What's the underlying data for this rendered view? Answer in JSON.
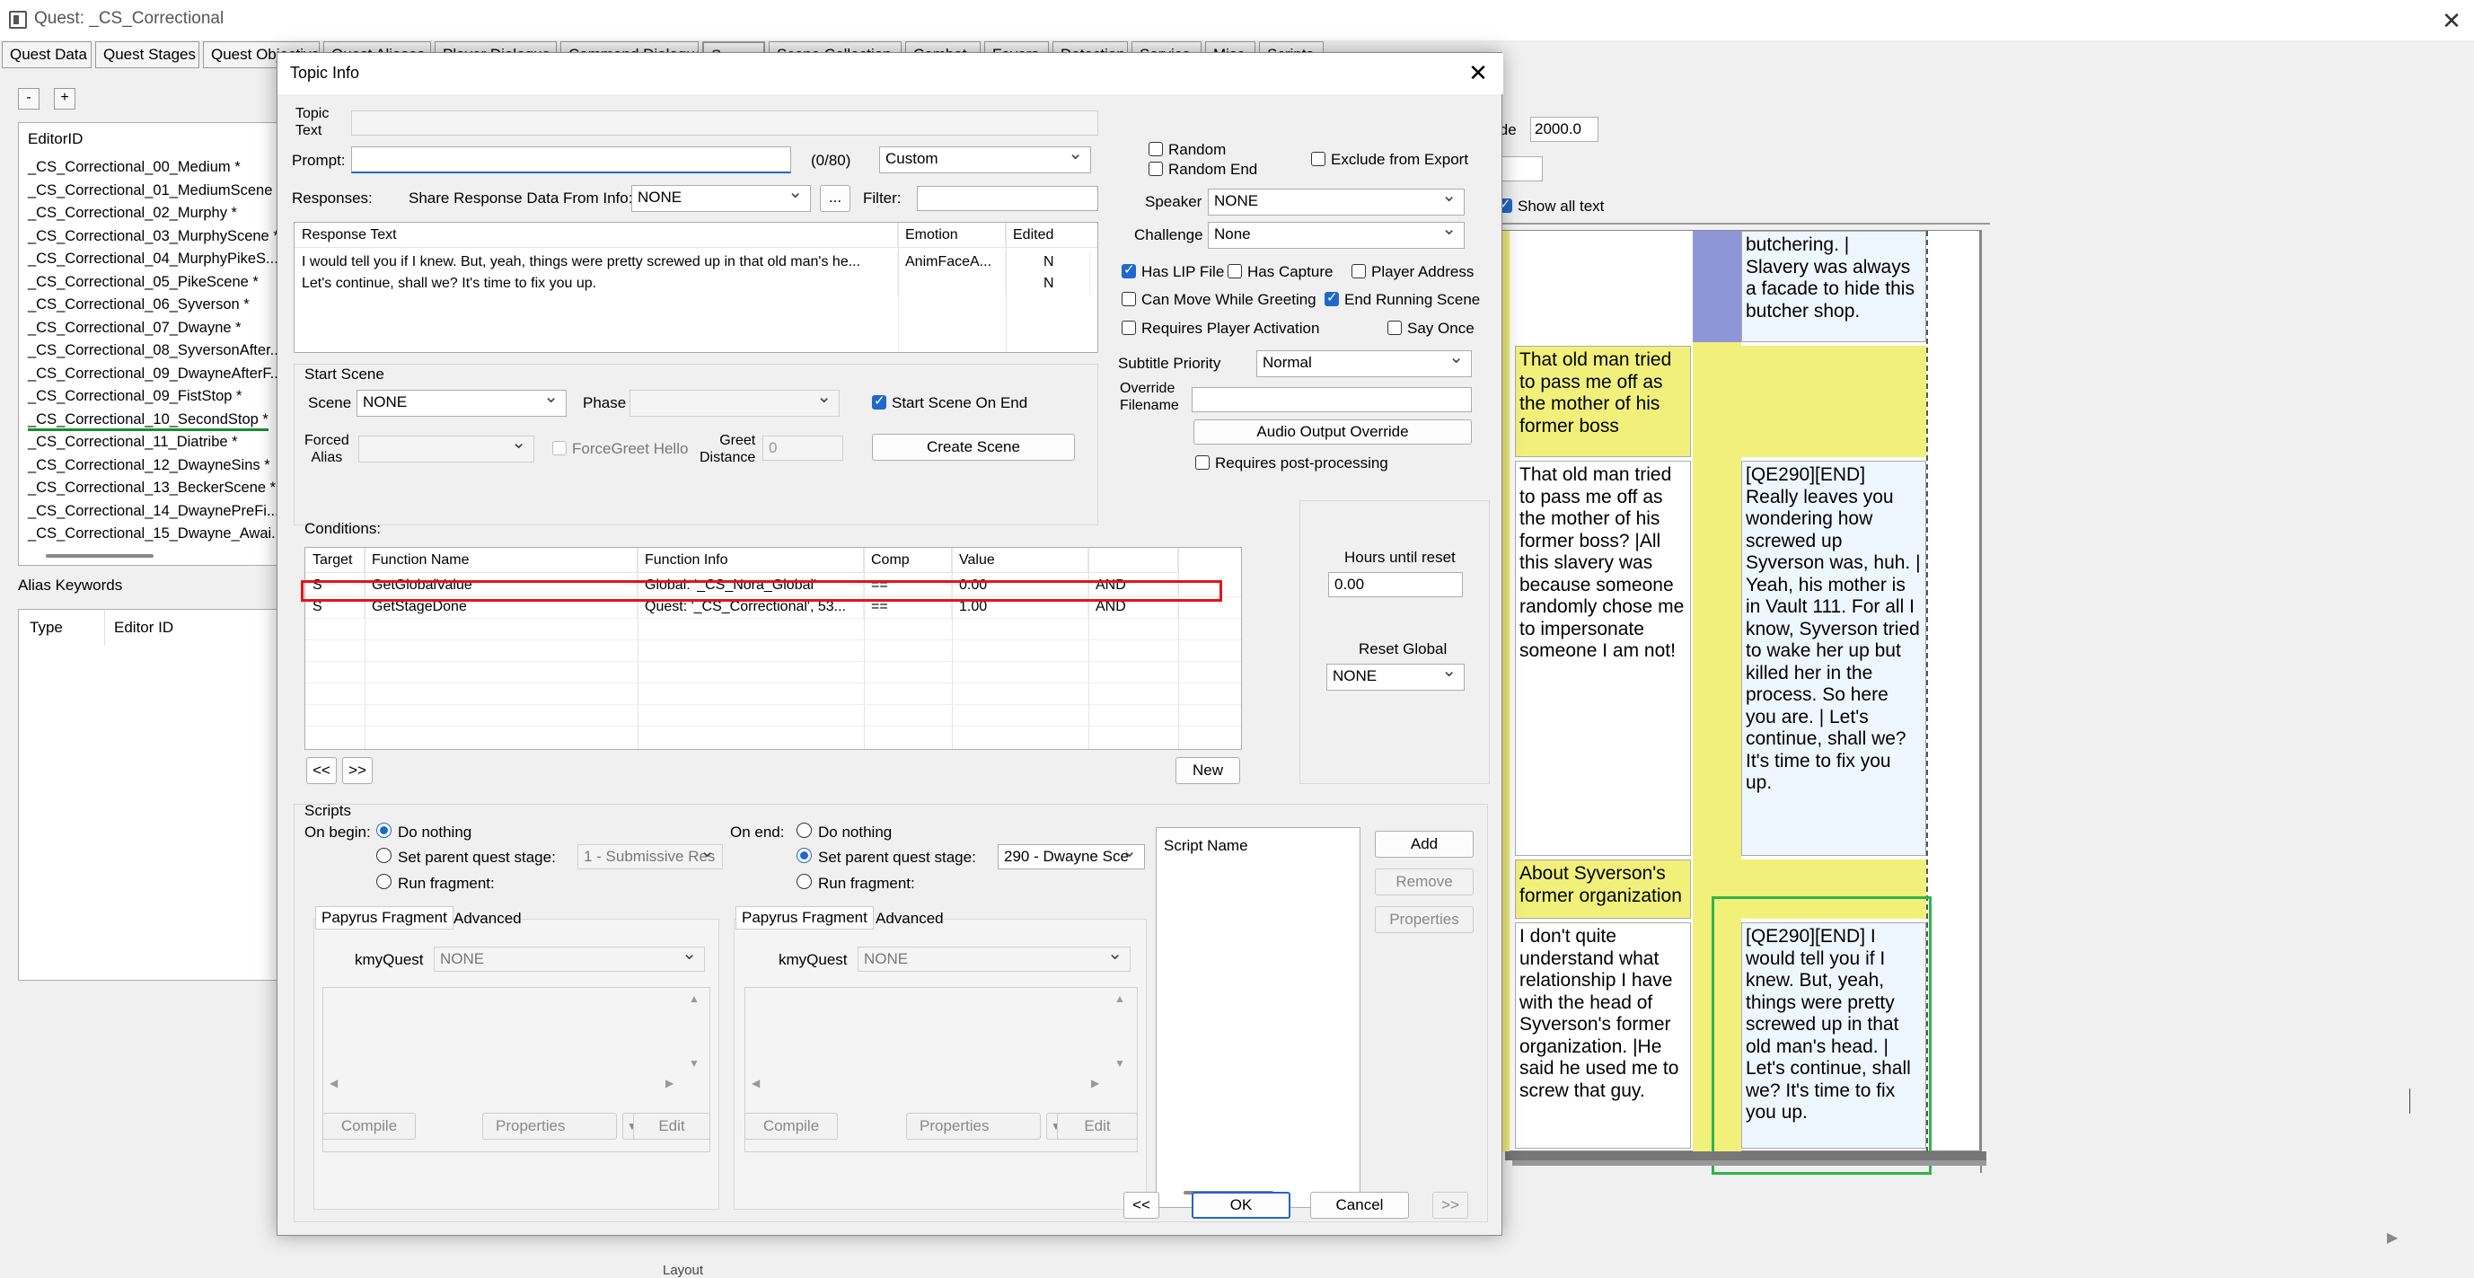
{
  "main": {
    "title": "Quest: _CS_Correctional",
    "tabs": [
      "Quest Data",
      "Quest Stages",
      "Quest Objectives",
      "Quest Aliases",
      "Player Dialogue",
      "Command Dialogue",
      "Sc...",
      "Scene Collection",
      "Combat",
      "Favors",
      "Detection",
      "Service",
      "Misc",
      "Scripts"
    ],
    "minus": "-",
    "plus": "+",
    "editor_header": "EditorID",
    "editor_items": [
      "_CS_Correctional_00_Medium *",
      "_CS_Correctional_01_MediumScene *",
      "_CS_Correctional_02_Murphy *",
      "_CS_Correctional_03_MurphyScene *",
      "_CS_Correctional_04_MurphyPikeS...",
      "_CS_Correctional_05_PikeScene *",
      "_CS_Correctional_06_Syverson *",
      "_CS_Correctional_07_Dwayne *",
      "_CS_Correctional_08_SyversonAfter...",
      "_CS_Correctional_09_DwayneAfterF...",
      "_CS_Correctional_09_FistStop *",
      "_CS_Correctional_10_SecondStop *",
      "_CS_Correctional_11_Diatribe *",
      "_CS_Correctional_12_DwayneSins *",
      "_CS_Correctional_13_BeckerScene *",
      "_CS_Correctional_14_DwaynePreFi...",
      "_CS_Correctional_15_Dwayne_Awai..."
    ],
    "alias_label": "Alias Keywords",
    "alias_cols": [
      "Type",
      "Editor ID"
    ],
    "bg_label": "ide",
    "bg_value": "2000.0",
    "show_all_text": "Show all text",
    "layout_label": "Layout"
  },
  "right_panel": {
    "c1": "butchering. |\nSlavery was always a facade to hide this butcher shop.",
    "c2": "That old man tried to pass me off as the mother of his former boss",
    "c3": "That old man tried to pass me off as the mother of his former boss? |All this slavery was because someone randomly chose me to impersonate someone I am not!",
    "c4": "[QE290][END]\nReally leaves you wondering how screwed up Syverson was, huh. | Yeah, his mother is in Vault 111. For all I know, Syverson tried to wake her up but killed her in the process. So here you are. | Let's continue, shall we? It's time to fix you up.",
    "c5": "About Syverson's former organization",
    "c6": "I don't quite understand what relationship I have with the head of Syverson's former organization. |He said he used me to screw that guy.",
    "c7": "[QE290][END] I would tell you if I knew. But, yeah, things were pretty screwed up in that old man's head. | Let's continue, shall we? It's time to fix you up."
  },
  "dialog": {
    "title": "Topic Info",
    "topic_text_label": "Topic\nText",
    "prompt_label": "Prompt:",
    "prompt_counter": "(0/80)",
    "prompt_type": "Custom",
    "responses_label": "Responses:",
    "share_label": "Share Response Data From Info:",
    "share_value": "NONE",
    "ellipsis": "...",
    "filter_label": "Filter:",
    "resp_cols": [
      "Response Text",
      "Emotion",
      "Edited"
    ],
    "resp_rows": [
      [
        "I would tell you if I knew. But, yeah, things were pretty screwed up in that old man's he...",
        "AnimFaceA...",
        "N"
      ],
      [
        "Let's continue, shall we? It's time to fix you up.",
        "",
        "N"
      ]
    ],
    "random": "Random",
    "random_end": "Random End",
    "exclude_export": "Exclude from Export",
    "speaker_label": "Speaker",
    "speaker_value": "NONE",
    "challenge_label": "Challenge",
    "challenge_value": "None",
    "has_lip": "Has LIP File",
    "has_capture": "Has Capture",
    "player_address": "Player Address",
    "can_move": "Can Move While Greeting",
    "end_running": "End Running Scene",
    "req_activation": "Requires Player Activation",
    "say_once": "Say Once",
    "subtitle_label": "Subtitle Priority",
    "subtitle_value": "Normal",
    "override_label": "Override\nFilename",
    "audio_override": "Audio Output Override",
    "req_post": "Requires post-processing",
    "start_scene_label": "Start Scene",
    "scene_label": "Scene",
    "scene_value": "NONE",
    "phase_label": "Phase",
    "start_on_end": "Start Scene On End",
    "forced_alias": "Forced\nAlias",
    "force_greet": "ForceGreet Hello",
    "greet_dist": "Greet\nDistance",
    "greet_value": "0",
    "create_scene": "Create Scene",
    "conditions_label": "Conditions:",
    "cond_cols": [
      "Target",
      "Function Name",
      "Function Info",
      "Comp",
      "Value",
      ""
    ],
    "cond_rows": [
      [
        "S",
        "GetGlobalValue",
        "Global: '_CS_Nora_Global'",
        "==",
        "0.00",
        "AND"
      ],
      [
        "S",
        "GetStageDone",
        "Quest: '_CS_Correctional', 53...",
        "==",
        "1.00",
        "AND"
      ]
    ],
    "prev": "<<",
    "next": ">>",
    "new_btn": "New",
    "hours_label": "Hours until reset",
    "hours_value": "0.00",
    "reset_global_label": "Reset Global",
    "reset_global_value": "NONE",
    "scripts_label": "Scripts",
    "on_begin": "On begin:",
    "do_nothing": "Do nothing",
    "set_parent": "Set parent quest stage:",
    "run_fragment": "Run fragment:",
    "begin_stage": "1 - Submissive Res",
    "on_end": "On end:",
    "end_stage": "290 - Dwayne Sce",
    "papyrus": "Papyrus Fragment",
    "advanced": "Advanced",
    "kmy_label": "kmyQuest",
    "kmy_value": "NONE",
    "compile": "Compile",
    "properties": "Properties",
    "edit": "Edit",
    "script_name": "Script Name",
    "add": "Add",
    "remove": "Remove",
    "props_btn": "Properties",
    "ok": "OK",
    "cancel": "Cancel"
  },
  "colors": {
    "highlight_red": "#e0161b",
    "highlight_green": "#2fb34a",
    "underline_green": "#1a8c2f",
    "yellow_cell": "#f1f07b",
    "blue_cell": "#eef6ff",
    "purple_cell": "#8e96d8",
    "accent": "#2167c9"
  }
}
